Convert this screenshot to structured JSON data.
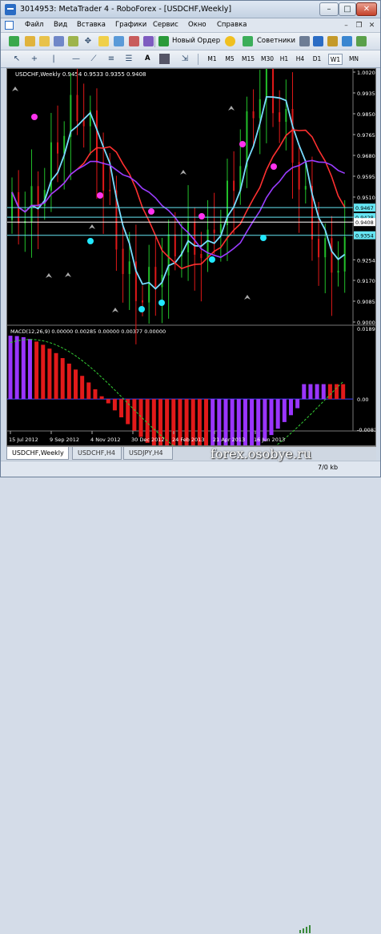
{
  "window": {
    "title": "3014953: MetaTrader 4 - RoboForex - [USDCHF,Weekly]",
    "minimize": "–",
    "maximize": "□",
    "close": "✕"
  },
  "menu": {
    "items": [
      "Файл",
      "Вид",
      "Вставка",
      "Графики",
      "Сервис",
      "Окно",
      "Справка"
    ],
    "mdi_min": "–",
    "mdi_restore": "❐",
    "mdi_close": "✕"
  },
  "toolbar": {
    "new_order": "Новый Ордер",
    "advisors": "Советники",
    "text_tool": "A",
    "timeframes": [
      "M1",
      "M5",
      "M15",
      "M30",
      "H1",
      "H4",
      "D1",
      "W1",
      "MN"
    ],
    "active_timeframe": "W1"
  },
  "chart": {
    "header": "USDCHF,Weekly  0.9454 0.9533 0.9355 0.9408",
    "price_labels": [
      "1.0020",
      "0.9935",
      "0.9850",
      "0.9765",
      "0.9680",
      "0.9595",
      "0.9510",
      "0.9428",
      "0.9408",
      "0.9254",
      "0.9170",
      "0.9085",
      "0.9000"
    ],
    "marked_prices": [
      {
        "value": "0.9467",
        "color": "#66e6f4"
      },
      {
        "value": "0.9428",
        "color": "#66e6f4"
      },
      {
        "value": "0.9408",
        "color": "#ffffff"
      },
      {
        "value": "0.9354",
        "color": "#66e6f4"
      }
    ],
    "macd_header": "MACD(12,26,9)  0.00000  0.00285  0.00000  0.00377  0.00000",
    "macd_labels": [
      "0.01895",
      "0.00",
      "-0.00813"
    ],
    "date_labels": [
      "15 Jul 2012",
      "9 Sep 2012",
      "4 Nov 2012",
      "30 Dec 2012",
      "24 Feb 2013",
      "21 Apr 2013",
      "16 Jun 2013"
    ]
  },
  "tabs": [
    "USDCHF,Weekly",
    "USDCHF,H4",
    "USDJPY,H4"
  ],
  "active_tab": "USDCHF,Weekly",
  "status": {
    "traffic": "7/0 kb"
  },
  "watermark": "forex.osobye.ru",
  "colors": {
    "bull": "#22c02a",
    "bear": "#e01818",
    "ma_cyan": "#79dcff",
    "ma_red": "#ff3030",
    "ma_purple": "#9a3cff",
    "macd_up": "#9a35ff",
    "macd_down": "#e21a1a",
    "signal": "#35d035",
    "dot_magenta": "#ff33ee",
    "dot_cyan": "#22e8ff"
  }
}
